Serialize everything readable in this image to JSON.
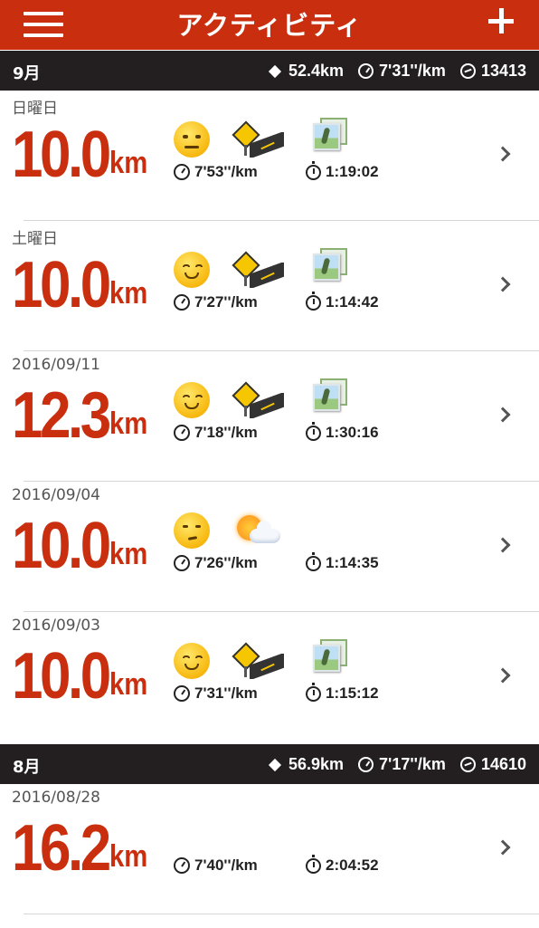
{
  "header": {
    "title": "アクティビティ"
  },
  "months": [
    {
      "label": "9月",
      "distance": "52.4km",
      "pace": "7'31''/km",
      "fuel": "13413"
    },
    {
      "label": "8月",
      "distance": "56.9km",
      "pace": "7'17''/km",
      "fuel": "14610"
    }
  ],
  "runs": [
    {
      "date": "日曜日",
      "distance": "10.0",
      "unit": "km",
      "pace": "7'53''/km",
      "time": "1:19:02",
      "mood": "neutral-face-icon",
      "terrain": "road-icon",
      "photo": true
    },
    {
      "date": "土曜日",
      "distance": "10.0",
      "unit": "km",
      "pace": "7'27''/km",
      "time": "1:14:42",
      "mood": "smile-face-icon",
      "terrain": "road-icon",
      "photo": true
    },
    {
      "date": "2016/09/11",
      "distance": "12.3",
      "unit": "km",
      "pace": "7'18''/km",
      "time": "1:30:16",
      "mood": "smile-face-icon",
      "terrain": "road-icon",
      "photo": true
    },
    {
      "date": "2016/09/04",
      "distance": "10.0",
      "unit": "km",
      "pace": "7'26''/km",
      "time": "1:14:35",
      "mood": "meh-face-icon",
      "terrain": "weather-icon",
      "photo": false
    },
    {
      "date": "2016/09/03",
      "distance": "10.0",
      "unit": "km",
      "pace": "7'31''/km",
      "time": "1:15:12",
      "mood": "smile-face-icon",
      "terrain": "road-icon",
      "photo": true
    },
    {
      "date": "2016/08/28",
      "distance": "16.2",
      "unit": "km",
      "pace": "7'40''/km",
      "time": "2:04:52",
      "mood": "",
      "terrain": "",
      "photo": false
    }
  ],
  "colors": {
    "accent": "#c92f0f",
    "month_bar": "#231f20"
  }
}
